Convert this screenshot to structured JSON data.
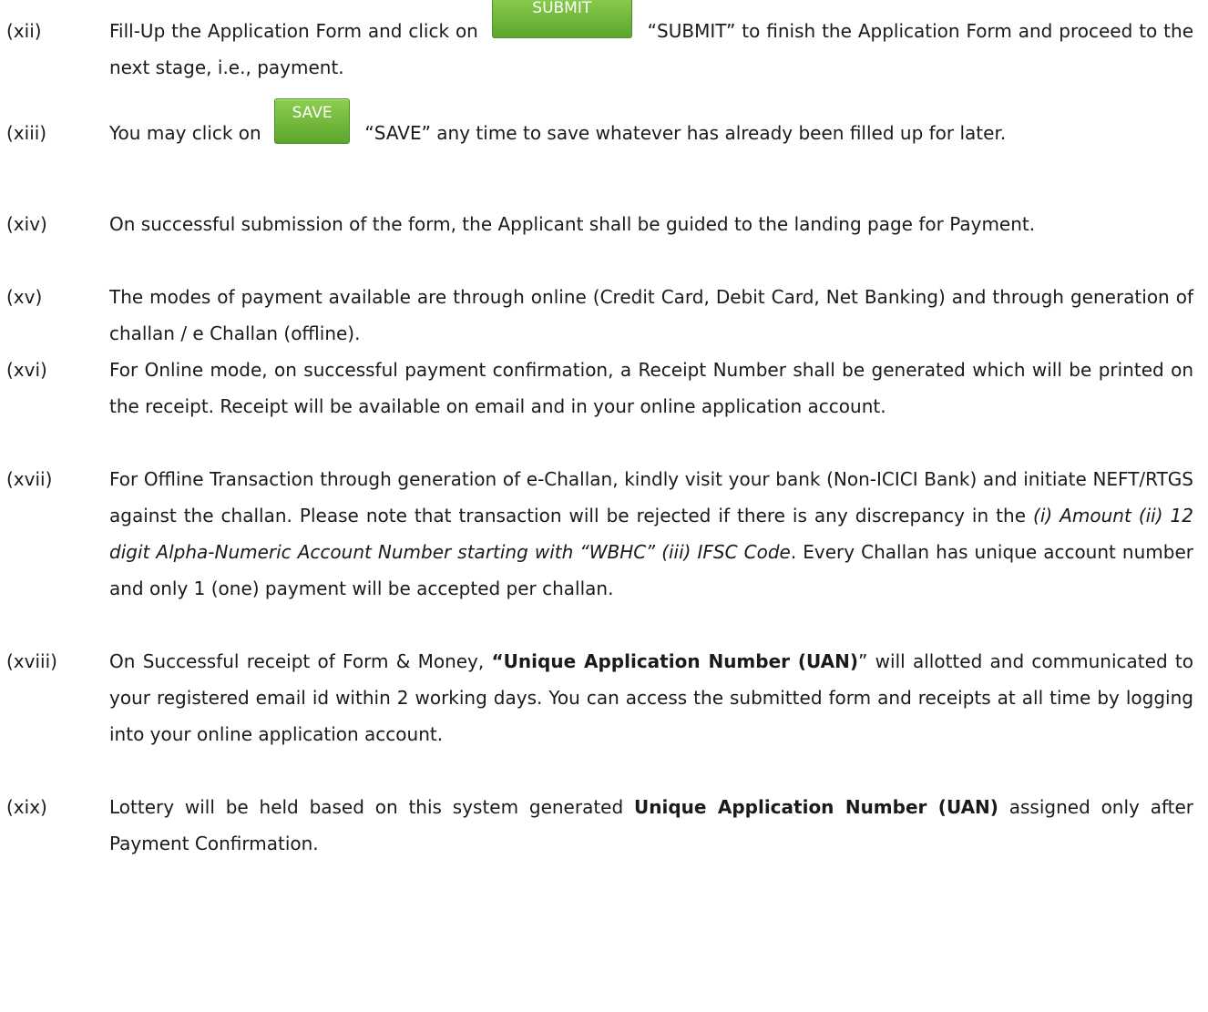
{
  "items": [
    {
      "num": "(xii)",
      "parts": [
        {
          "t": "Fill-Up the Application Form and click on "
        },
        {
          "btn": "SUBMIT",
          "name": "submit-button",
          "cls": "btn-submit"
        },
        {
          "t": " “SUBMIT” to finish the Application Form and proceed to the next stage, i.e., payment."
        }
      ]
    },
    {
      "num": "(xiii)",
      "parts": [
        {
          "t": "You may click on "
        },
        {
          "btn": "SAVE",
          "name": "save-button",
          "cls": "btn-save"
        },
        {
          "t": " “SAVE” any time to save whatever has already been filled up for later."
        }
      ]
    },
    {
      "num": "(xiv)",
      "parts": [
        {
          "t": "On successful submission of the form, the Applicant shall be guided to the landing page for Payment."
        }
      ]
    },
    {
      "num": "(xv)",
      "parts": [
        {
          "t": "The modes of payment available are through online (Credit Card, Debit Card, Net Banking) and through generation of challan / e Challan (offline)."
        }
      ]
    },
    {
      "num": "(xvi)",
      "parts": [
        {
          "t": "For Online mode, on successful payment confirmation, a Receipt Number shall be generated which will be printed on the receipt. Receipt will be available on email and in your online application account."
        }
      ]
    },
    {
      "num": "(xvii)",
      "parts": [
        {
          "t": "For Offline Transaction through generation of e-Challan, kindly visit your bank (Non-ICICI Bank) and initiate NEFT/RTGS against the challan. Please note that transaction will be rejected if there is any discrepancy in the "
        },
        {
          "t": "(i) Amount (ii) 12 digit Alpha-Numeric Account Number starting with “WBHC” (iii) IFSC Code",
          "style": "i"
        },
        {
          "t": ". Every Challan has unique account number and only 1 (one) payment will be accepted per challan."
        }
      ]
    },
    {
      "num": "(xviii)",
      "parts": [
        {
          "t": "On Successful receipt of Form & Money, "
        },
        {
          "t": "“Unique Application Number (UAN)",
          "style": "b"
        },
        {
          "t": "” will allotted and communicated to your registered email id within 2 working days. You can access the submitted form and receipts at all time by logging into your online application account."
        }
      ]
    },
    {
      "num": "(xix)",
      "parts": [
        {
          "t": "Lottery will be held based on this system generated "
        },
        {
          "t": "Unique Application Number (UAN)",
          "style": "b"
        },
        {
          "t": " assigned only after Payment Confirmation."
        }
      ]
    }
  ]
}
